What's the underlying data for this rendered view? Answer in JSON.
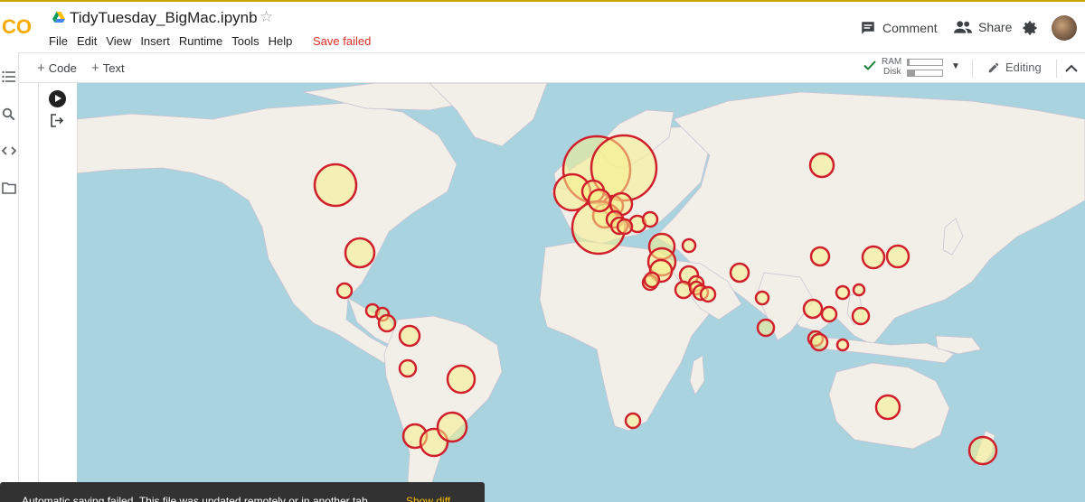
{
  "app": {
    "logo_text": "CO",
    "notebook_title": "TidyTuesday_BigMac.ipynb",
    "save_status": "Save failed"
  },
  "menu": [
    "File",
    "Edit",
    "View",
    "Insert",
    "Runtime",
    "Tools",
    "Help"
  ],
  "header": {
    "comment_label": "Comment",
    "share_label": "Share"
  },
  "toolbar": {
    "code_label": "Code",
    "text_label": "Text",
    "ram_label": "RAM",
    "disk_label": "Disk",
    "ram_usage": 0.05,
    "disk_usage": 0.2,
    "mode_label": "Editing"
  },
  "icons": {
    "sidebar": [
      "toc-icon",
      "search-icon",
      "code-snippets-icon",
      "files-icon"
    ]
  },
  "map": {
    "colors": {
      "water": "#a9d3df",
      "land": "#f2efe9",
      "circle_stroke": "#d0202c",
      "circle_fill": "#f5f08a"
    }
  },
  "toast": {
    "message": "Automatic saving failed. This file was updated remotely or in another tab.",
    "action_label": "Show diff"
  }
}
